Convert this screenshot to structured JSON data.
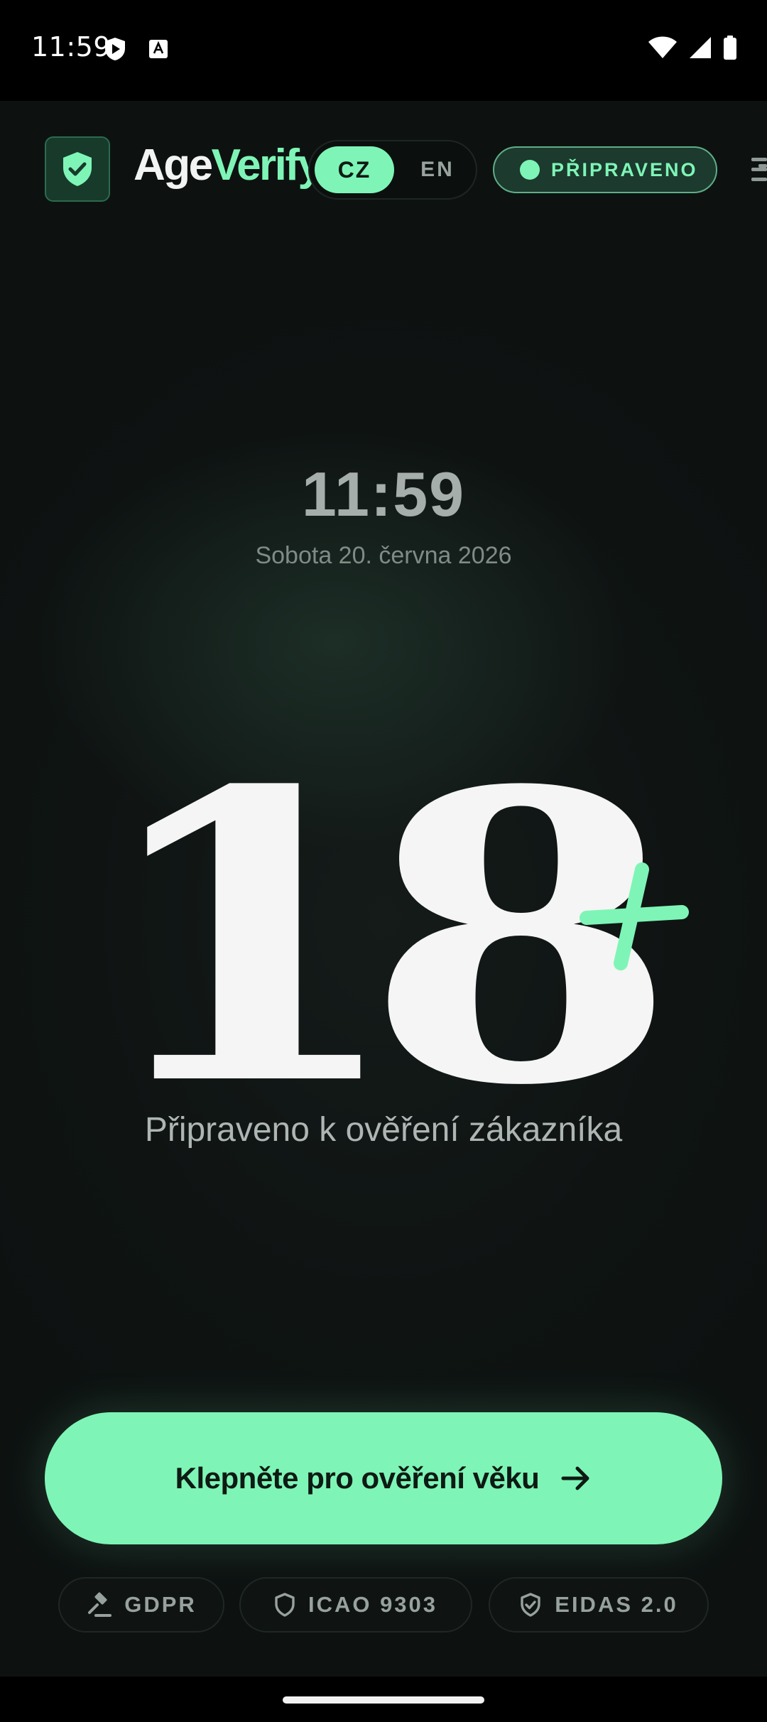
{
  "status_bar": {
    "time": "11:59"
  },
  "header": {
    "brand_part1": "Age",
    "brand_part2": "Verify",
    "lang_cz": "CZ",
    "lang_en": "EN",
    "status": "PŘIPRAVENO"
  },
  "main": {
    "clock": "11:59",
    "date": "Sobota 20. června 2026",
    "age_number": "18",
    "age_plus": "+",
    "ready_text": "Připraveno k ověření zákazníka"
  },
  "cta": {
    "label": "Klepněte pro ověření věku"
  },
  "badges": [
    {
      "label": "GDPR",
      "icon": "gavel-icon"
    },
    {
      "label": "ICAO 9303",
      "icon": "shield-icon"
    },
    {
      "label": "EIDAS 2.0",
      "icon": "shield-check-icon"
    }
  ],
  "colors": {
    "accent": "#7ef5b6",
    "background": "#0f1413",
    "text_primary": "#f4f5f4",
    "text_muted": "#97a19d"
  }
}
